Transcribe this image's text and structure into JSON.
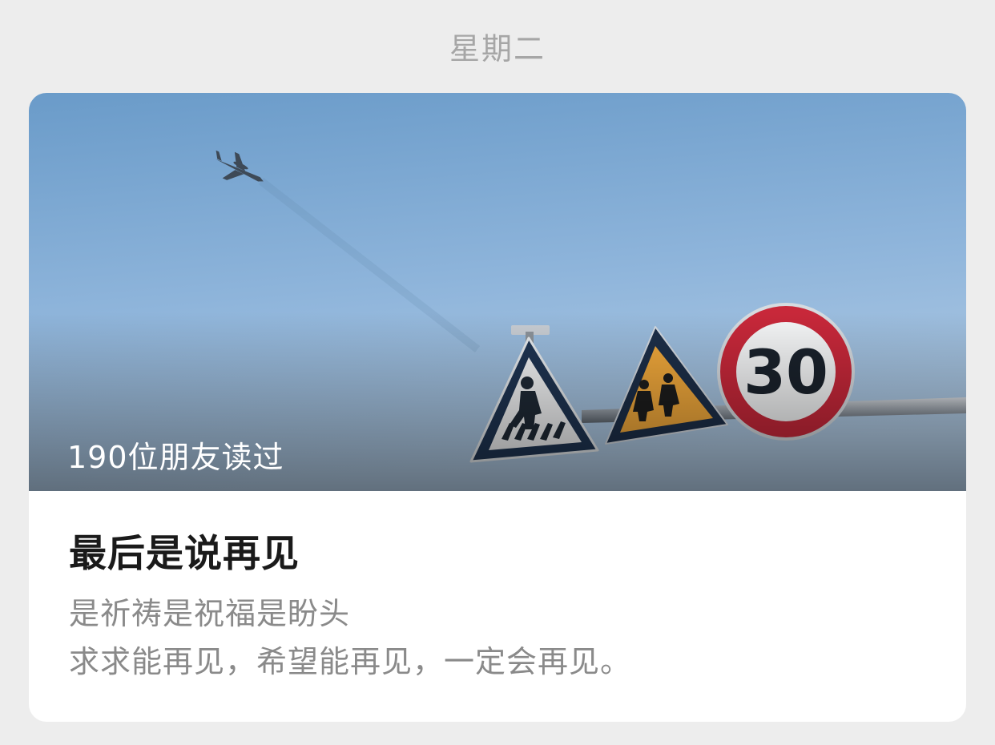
{
  "header": {
    "day_label": "星期二"
  },
  "article": {
    "read_count_label": "190位朋友读过",
    "title": "最后是说再见",
    "summary_lines": [
      "是祈祷是祝福是盼头",
      "求求能再见，希望能再见，一定会再见。"
    ],
    "cover_sign_speed": "30"
  },
  "colors": {
    "page_background": "#ededed",
    "card_background": "#ffffff",
    "day_label": "#a6a6a6",
    "title": "#1a1a1a",
    "summary": "#8a8a8a",
    "sky_top": "#6b9cca",
    "sky_bottom": "#a9c6e2",
    "sign_red": "#c8283a",
    "sign_yellow": "#f2a93b"
  }
}
